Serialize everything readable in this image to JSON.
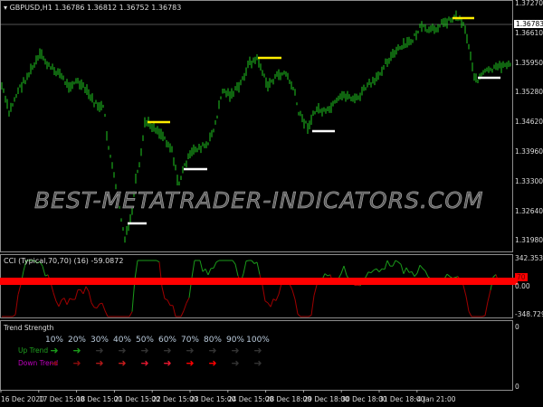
{
  "header": {
    "symbol": "GBPUSD,H1",
    "ohlc": "1.36786 1.36812 1.36752 1.36783"
  },
  "price_scale": [
    "1.37270",
    "1.36610",
    "1.35950",
    "1.35280",
    "1.34620",
    "1.33960",
    "1.33300",
    "1.32640",
    "1.31980"
  ],
  "current_price": "1.36783",
  "watermark": "BEST-METATRADER-INDICATORS.COM",
  "cci": {
    "title": "CCI (Typical,70,70) (16) -59.0872",
    "scale": [
      "342.3532",
      "0.00",
      "-348.7291"
    ],
    "level": "70"
  },
  "trend_strength": {
    "title": "Trend Strength",
    "scale": [
      "0",
      "0"
    ],
    "percents": [
      "10%",
      "20%",
      "30%",
      "40%",
      "50%",
      "60%",
      "70%",
      "80%",
      "90%",
      "100%"
    ],
    "up_label": "Up Trend",
    "down_label": "Down Trend",
    "up_colors": [
      "#1a9a1a",
      "#1a9a1a",
      "#333333",
      "#333333",
      "#333333",
      "#333333",
      "#333333",
      "#333333",
      "#333333",
      "#333333"
    ],
    "down_colors": [
      "#7a0a0a",
      "#8a0c0c",
      "#b01818",
      "#c81c1c",
      "#e01830",
      "#e81830",
      "#ff0000",
      "#ff0000",
      "#333333",
      "#333333"
    ]
  },
  "time_axis": [
    "16 Dec 2020",
    "17 Dec 15:00",
    "18 Dec 15:00",
    "21 Dec 15:00",
    "22 Dec 15:00",
    "23 Dec 15:00",
    "24 Dec 15:00",
    "28 Dec 18:00",
    "29 Dec 18:00",
    "30 Dec 18:00",
    "31 Dec 18:00",
    "4 Jan 21:00"
  ],
  "colors": {
    "candle": "#1fc81f",
    "yellow": "#ffee00",
    "white": "#ffffff",
    "cci_up": "#1a9a1a",
    "cci_down": "#a00000",
    "band": "#ff0000"
  }
}
